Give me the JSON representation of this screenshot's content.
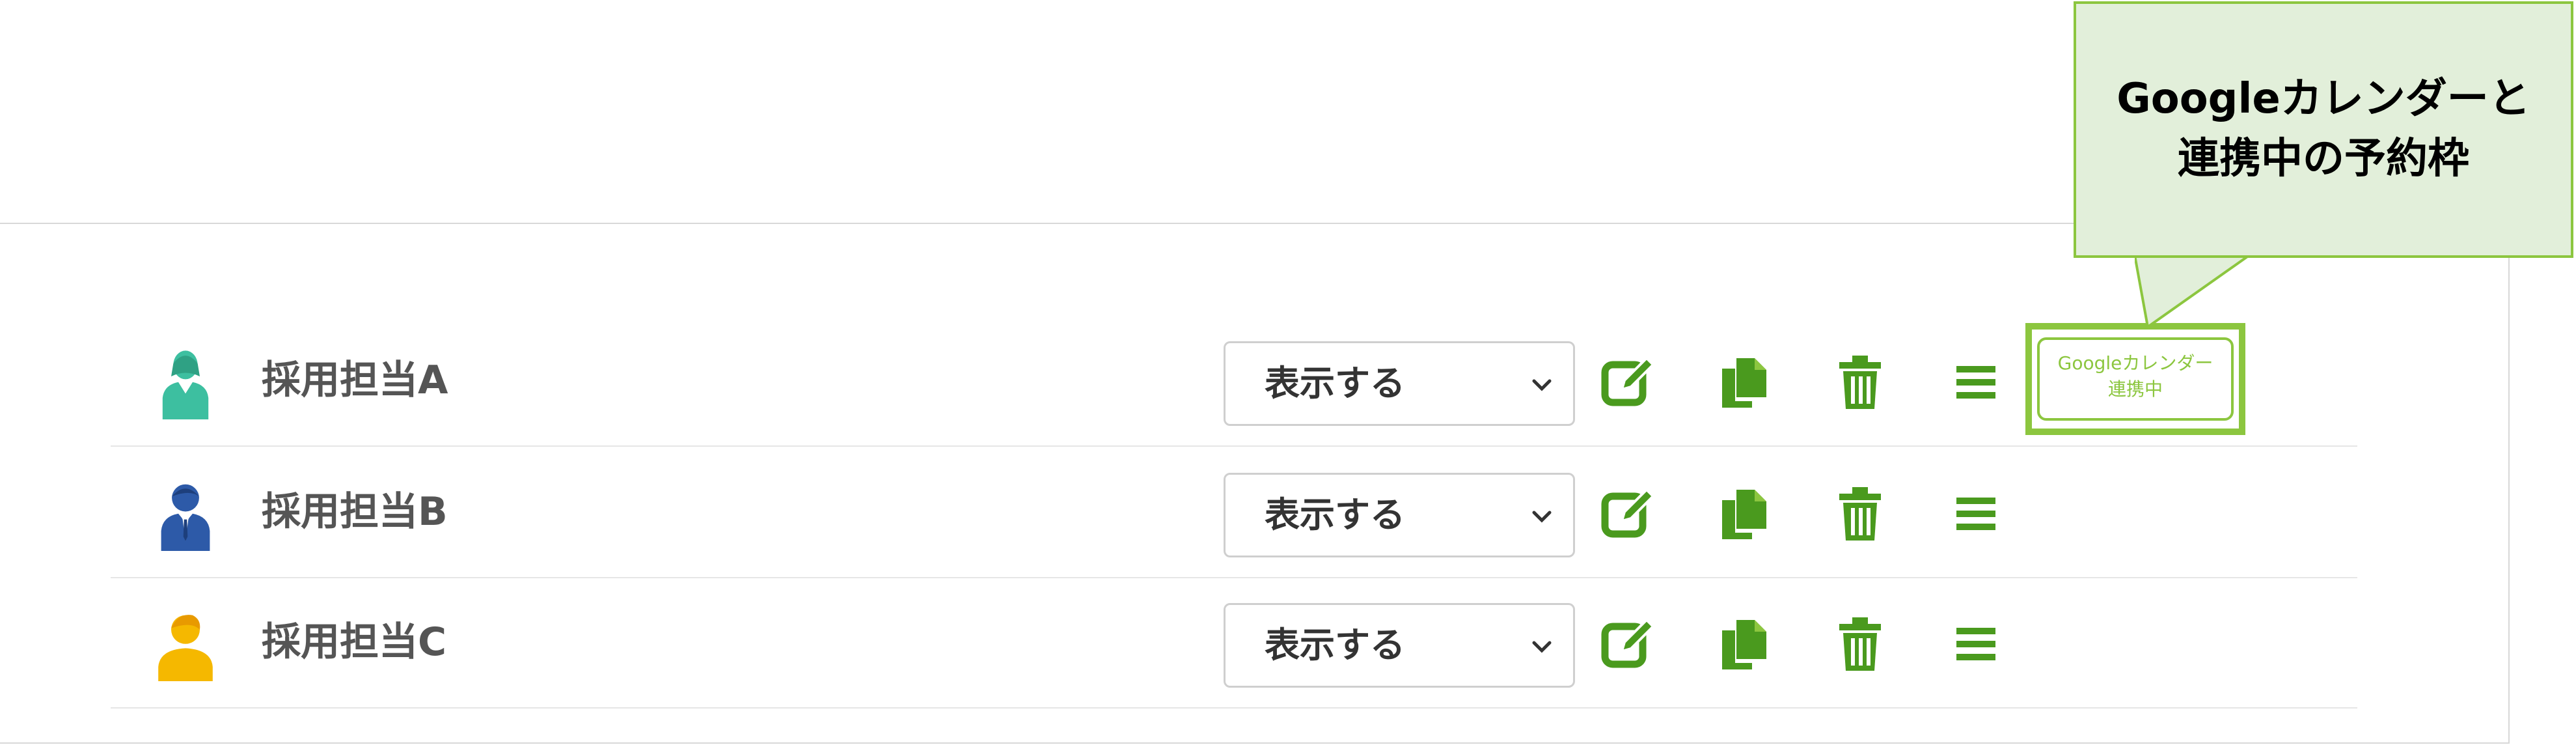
{
  "rows": [
    {
      "name": "採用担当A",
      "visibility": "表示する",
      "avatar_color": "#3dbfa0",
      "gcal_linked": true
    },
    {
      "name": "採用担当B",
      "visibility": "表示する",
      "avatar_color": "#2d5aa8",
      "gcal_linked": false
    },
    {
      "name": "採用担当C",
      "visibility": "表示する",
      "avatar_color": "#f5b800",
      "gcal_linked": false
    }
  ],
  "visibility_options": [
    "表示する"
  ],
  "gcal_badge": {
    "line1": "Googleカレンダー",
    "line2": "連携中"
  },
  "callout": {
    "line1": "Googleカレンダーと",
    "line2": "連携中の予約枠"
  },
  "colors": {
    "accent": "#4a9a1e",
    "highlight": "#8cc63f",
    "callout_bg": "#e2efda",
    "text": "#555555"
  },
  "icons": [
    "edit-icon",
    "copy-icon",
    "trash-icon",
    "menu-icon",
    "chevron-down-icon",
    "avatar-icon"
  ]
}
